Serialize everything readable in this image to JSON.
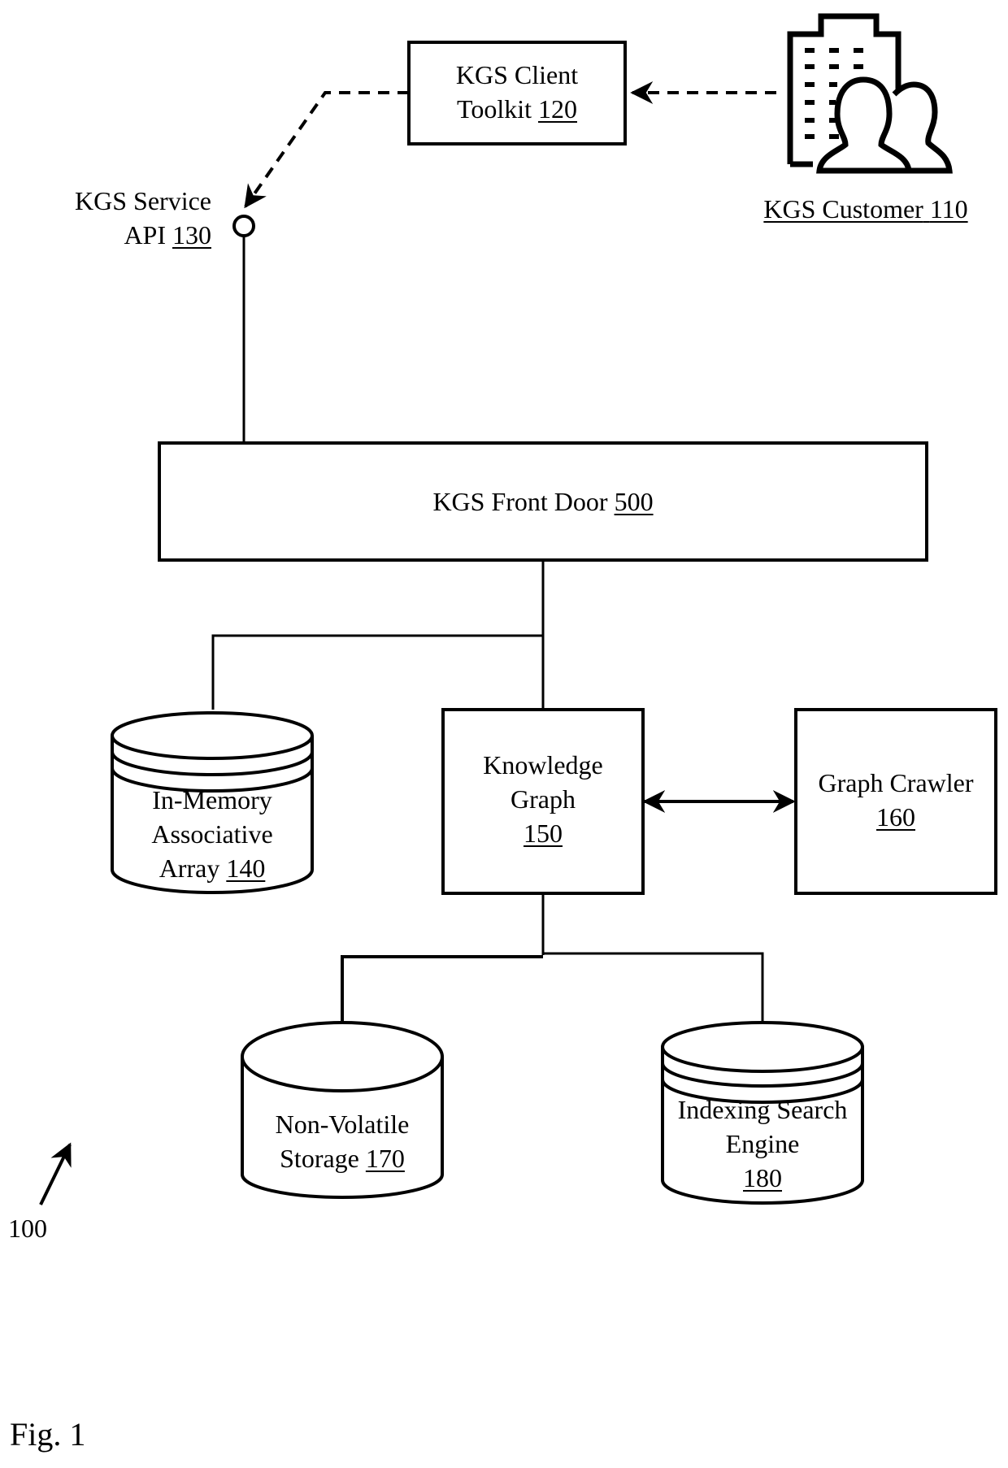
{
  "figure": {
    "caption": "Fig. 1",
    "system_ref": "100"
  },
  "nodes": {
    "customer": {
      "label": "KGS Customer",
      "ref": "110",
      "icon": "building-people-icon"
    },
    "client_toolkit": {
      "label_line1": "KGS Client",
      "label_line2": "Toolkit",
      "ref": "120"
    },
    "service_api": {
      "label_line1": "KGS Service",
      "label_line2": "API",
      "ref": "130",
      "icon": "interface-circle-icon"
    },
    "front_door": {
      "label": "KGS Front Door",
      "ref": "500"
    },
    "assoc_array": {
      "label_line1": "In-Memory",
      "label_line2": "Associative",
      "label_line3": "Array",
      "ref": "140",
      "shape": "database-cylinder"
    },
    "knowledge_graph": {
      "label_line1": "Knowledge",
      "label_line2": "Graph",
      "ref": "150"
    },
    "graph_crawler": {
      "label": "Graph Crawler",
      "ref": "160"
    },
    "nv_storage": {
      "label_line1": "Non-Volatile",
      "label_line2": "Storage",
      "ref": "170",
      "shape": "database-cylinder"
    },
    "search_engine": {
      "label_line1": "Indexing Search",
      "label_line2": "Engine",
      "ref": "180",
      "shape": "database-cylinder"
    }
  },
  "edges": [
    {
      "from": "KGS Customer 110",
      "to": "KGS Client Toolkit 120",
      "style": "dashed-arrow"
    },
    {
      "from": "KGS Client Toolkit 120",
      "to": "KGS Service API 130",
      "style": "dashed-arrow"
    },
    {
      "from": "KGS Service API 130",
      "to": "KGS Front Door 500",
      "style": "solid"
    },
    {
      "from": "KGS Front Door 500",
      "to": "In-Memory Associative Array 140",
      "style": "solid"
    },
    {
      "from": "KGS Front Door 500",
      "to": "Knowledge Graph 150",
      "style": "solid"
    },
    {
      "from": "Knowledge Graph 150",
      "to": "Graph Crawler 160",
      "style": "bidirectional-arrow"
    },
    {
      "from": "Knowledge Graph 150",
      "to": "Non-Volatile Storage 170",
      "style": "solid"
    },
    {
      "from": "Knowledge Graph 150",
      "to": "Indexing Search Engine 180",
      "style": "solid"
    }
  ]
}
